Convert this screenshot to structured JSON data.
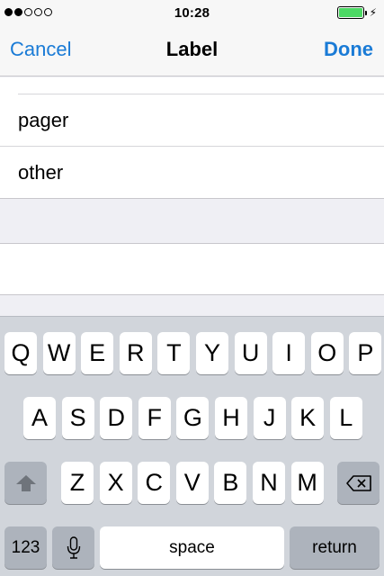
{
  "status_bar": {
    "signal_dots_filled": 2,
    "signal_dots_total": 5,
    "time": "10:28",
    "battery_color": "#4cd964"
  },
  "nav": {
    "cancel_label": "Cancel",
    "title": "Label",
    "done_label": "Done",
    "accent_color": "#1a7bd6"
  },
  "list": {
    "items": [
      {
        "label": "pager"
      },
      {
        "label": "other"
      }
    ]
  },
  "custom_field": {
    "value": ""
  },
  "keyboard": {
    "row1": [
      "Q",
      "W",
      "E",
      "R",
      "T",
      "Y",
      "U",
      "I",
      "O",
      "P"
    ],
    "row2": [
      "A",
      "S",
      "D",
      "F",
      "G",
      "H",
      "J",
      "K",
      "L"
    ],
    "row3": [
      "Z",
      "X",
      "C",
      "V",
      "B",
      "N",
      "M"
    ],
    "numbers_label": "123",
    "space_label": "space",
    "return_label": "return",
    "shift_icon": "shift-arrow-icon",
    "delete_icon": "backspace-icon",
    "mic_icon": "microphone-icon"
  }
}
